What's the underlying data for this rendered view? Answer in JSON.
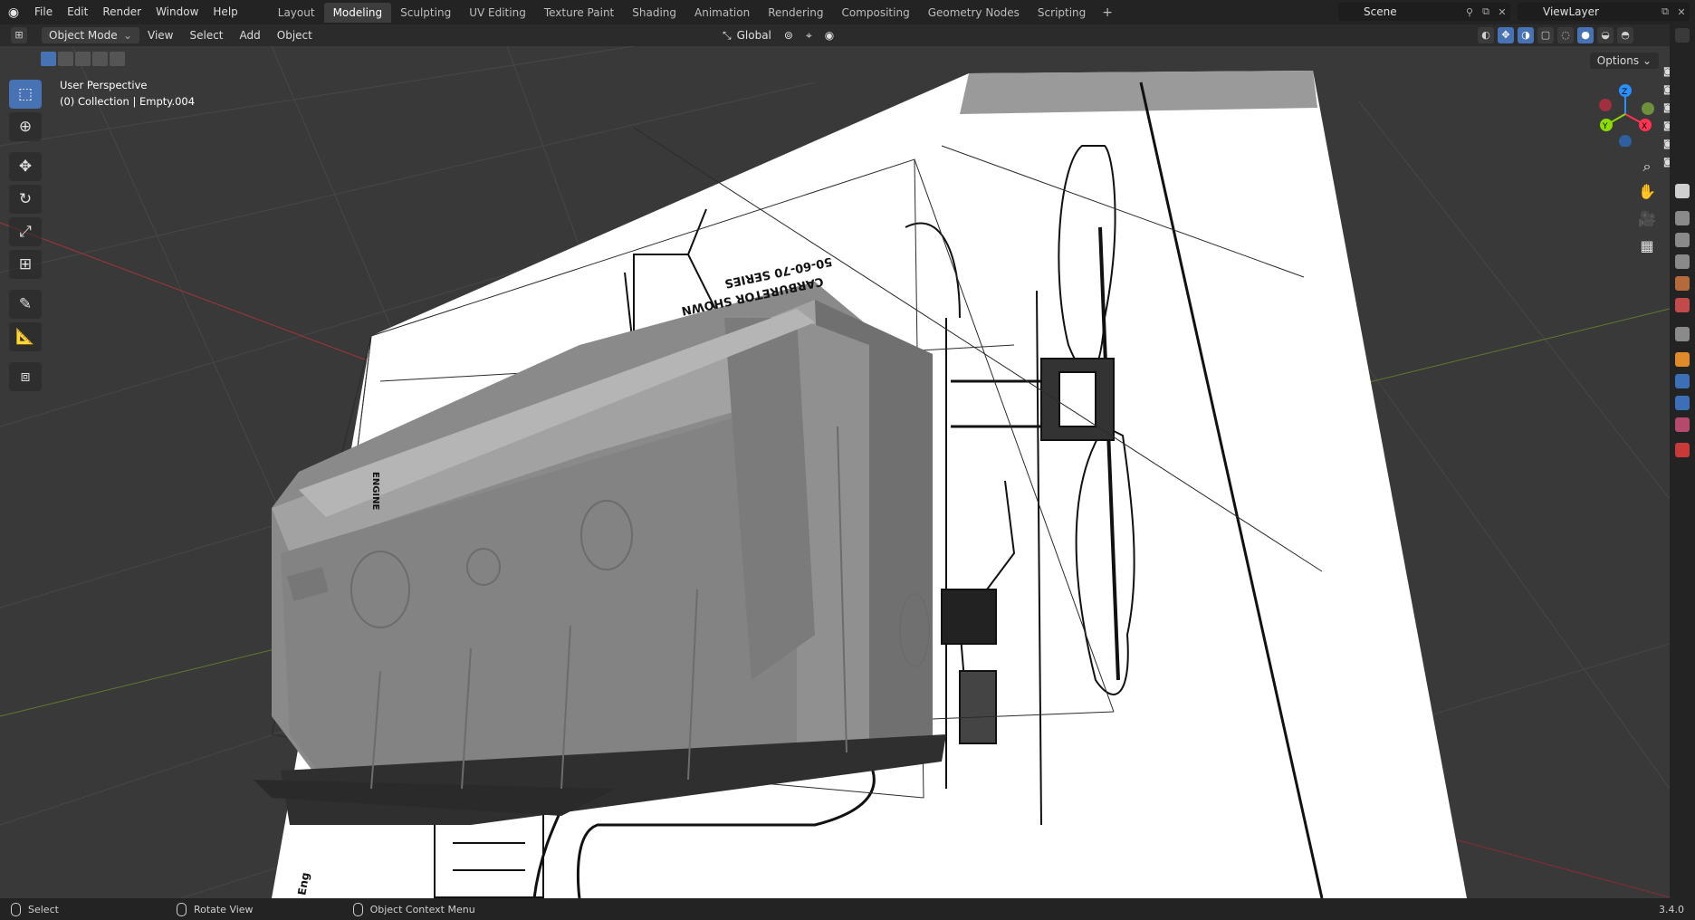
{
  "topbar": {
    "menu": [
      "File",
      "Edit",
      "Render",
      "Window",
      "Help"
    ],
    "workspaces": [
      "Layout",
      "Modeling",
      "Sculpting",
      "UV Editing",
      "Texture Paint",
      "Shading",
      "Animation",
      "Rendering",
      "Compositing",
      "Geometry Nodes",
      "Scripting"
    ],
    "active_workspace": "Modeling",
    "add_label": "+",
    "scene": "Scene",
    "view_layer": "ViewLayer"
  },
  "header": {
    "mode": "Object Mode",
    "menu": [
      "View",
      "Select",
      "Add",
      "Object"
    ],
    "orientation": "Global"
  },
  "viewport": {
    "perspective": "User Perspective",
    "collection": "(0) Collection | Empty.004",
    "options": "Options",
    "blueprint_text_1": "50-60-70 SERIES",
    "blueprint_text_2": "CARBURETOR SHOWN",
    "blueprint_text_3": "ENGINE",
    "blueprint_text_4": "Eng",
    "gizmo_axes": [
      "X",
      "Y",
      "Z"
    ]
  },
  "status": {
    "items": [
      "Select",
      "Rotate View",
      "Object Context Menu"
    ],
    "version": "3.4.0"
  },
  "colors": {
    "accent": "#4772b3",
    "x_axis": "#ff3352",
    "y_axis": "#8bdc00",
    "z_axis": "#2890ff"
  }
}
